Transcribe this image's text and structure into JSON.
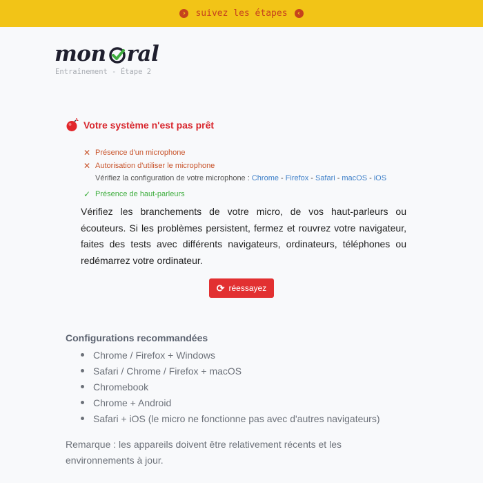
{
  "topbar": {
    "label": "suivez les étapes",
    "left_icon": "chevron-right-circle-icon",
    "right_icon": "chevron-left-circle-icon"
  },
  "logo": {
    "part1": "mon",
    "part2": "ral"
  },
  "subtitle": "Entraînement - Étape 2",
  "status": {
    "icon": "bomb-icon",
    "title": "Votre système n'est pas prêt",
    "color": "#d8262d"
  },
  "checks": {
    "microphone": "Présence d'un microphone",
    "authorization": "Autorisation d'utiliser le microphone",
    "config_prefix": "Vérifiez la configuration de votre microphone :",
    "config_links": [
      "Chrome",
      "Firefox",
      "Safari",
      "macOS",
      "iOS"
    ],
    "speakers": "Présence de haut-parleurs"
  },
  "advice": "Vérifiez les branchements de votre micro, de vos haut-parleurs ou écouteurs. Si les problèmes persistent, fermez et rouvrez votre navigateur, faites des tests avec différents navigateurs, ordinateurs, téléphones ou redémarrez votre ordinateur.",
  "retry_button": {
    "label": "réessayez",
    "icon": "refresh-icon",
    "color": "#e23031"
  },
  "recommended": {
    "title": "Configurations recommandées",
    "items": [
      "Chrome / Firefox + Windows",
      "Safari / Chrome / Firefox + macOS",
      "Chromebook",
      "Chrome + Android",
      "Safari + iOS (le micro ne fonctionne pas avec d'autres navigateurs)"
    ]
  },
  "remark": "Remarque : les appareils doivent être relativement récents et les environnements à jour.",
  "colors": {
    "topbar": "#f2c417",
    "error": "#c8532a",
    "ok": "#3fae3f",
    "link": "#3d7fc8"
  }
}
